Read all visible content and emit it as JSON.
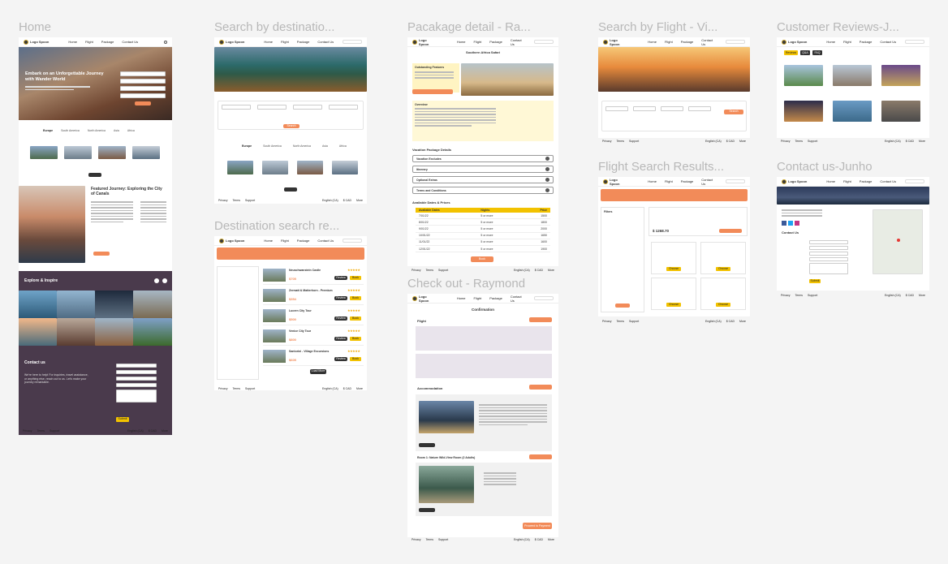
{
  "frames": {
    "home": {
      "title": "Home",
      "hero": "Embark on an Unforgettable Journey with Wander World",
      "tabs": [
        "Europe",
        "South America",
        "North America",
        "Asia",
        "Africa"
      ],
      "featured": "Featured Journey: Exploring the City of Canals",
      "explore": "Explore & Inspire",
      "contact": "Contact us",
      "contact_text": "We're here to help! For inquiries, travel assistance, or anything else, reach out to us. Let's make your journey remarkable.",
      "submit": "Submit"
    },
    "search_dest": {
      "title": "Search by destinatio...",
      "tabs": [
        "Europe",
        "South America",
        "North America",
        "Asia",
        "Africa"
      ],
      "button": "Search"
    },
    "dest_results": {
      "title": "Destination search re...",
      "results": [
        {
          "name": "Neuschwanstein Castle",
          "price": "$705"
        },
        {
          "name": "Zermatt & Matterhorn - Premium",
          "price": "$354"
        },
        {
          "name": "Lucern City Tour",
          "price": "$500"
        },
        {
          "name": "Venice City Tour",
          "price": "$800"
        },
        {
          "name": "Santorini - Village Excursions",
          "price": "$605"
        }
      ],
      "review": "Review",
      "book": "Book",
      "load_more": "Load More"
    },
    "package": {
      "title": "Pacakage detail - Ra...",
      "heading": "Southern Africa Safari",
      "highlights": "Outstanding Features",
      "overview": "Overview",
      "section": "Vacation Package Details",
      "accordions": [
        "Vacation Excludes",
        "Itinerary",
        "Optional Extras",
        "Terms and Conditions"
      ],
      "dates_title": "Available Dates & Prices",
      "table_head": [
        "Available Dates",
        "Nights",
        "Price"
      ],
      "table_rows": [
        [
          "7/01/22",
          "5 or more",
          "1500"
        ],
        [
          "8/01/22",
          "5 or more",
          "1800"
        ],
        [
          "9/01/22",
          "5 or more",
          "2000"
        ],
        [
          "10/01/22",
          "5 or more",
          "1650"
        ],
        [
          "11/01/22",
          "5 or more",
          "1600"
        ],
        [
          "12/01/22",
          "5 or more",
          "1900"
        ]
      ],
      "book": "Book"
    },
    "checkout": {
      "title": "Check out -  Raymond",
      "heading": "Confirmation",
      "flight": "Flight",
      "accommodation": "Accommodation",
      "room": "Room 1: Nature Wild-View Room (2 Adults)",
      "change": "Change Flight",
      "pay": "Proceed to Payment"
    },
    "search_flight": {
      "title": "Search by Flight - Vi...",
      "button": "Search"
    },
    "flight_results": {
      "title": "Flight Search Results...",
      "price": "$ 1268.70",
      "choose": "Choose",
      "filters": "Filters"
    },
    "reviews": {
      "title": "Customer Reviews-J...",
      "tabs": [
        "Reviews",
        "Q&A",
        "FAQ"
      ]
    },
    "contact": {
      "title": "Contact us-Junho",
      "heading": "Contact Us",
      "submit": "Submit"
    }
  },
  "nav": {
    "links": [
      "Home",
      "Flight",
      "Package",
      "Contact Us"
    ],
    "logo": "Logo Spoon"
  },
  "footer": {
    "left": [
      "Privacy",
      "Terms",
      "Support"
    ],
    "lang": "English (CA)",
    "cur": "$ CAD",
    "more": "More"
  },
  "colors": {
    "accent": "#f28b59",
    "yellow": "#f2c200",
    "dark": "#4a3a4c"
  }
}
